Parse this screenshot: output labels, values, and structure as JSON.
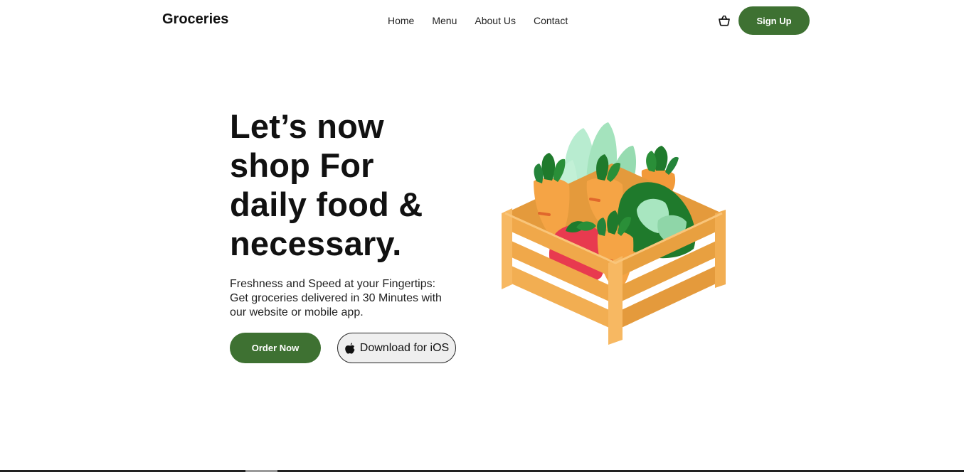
{
  "header": {
    "brand": "Groceries",
    "nav": [
      {
        "label": "Home"
      },
      {
        "label": "Menu"
      },
      {
        "label": "About Us"
      },
      {
        "label": "Contact"
      }
    ],
    "cart_icon": "shopping-basket-icon",
    "signup_label": "Sign Up"
  },
  "hero": {
    "title_lines": [
      "Let’s now",
      "shop For",
      "daily food &",
      "necessary."
    ],
    "subtitle_lines": [
      "Freshness and Speed at your Fingertips:",
      "Get groceries delivered in 30 Minutes with",
      "our website or mobile app."
    ],
    "order_label": "Order Now",
    "ios_label": "Download for iOS",
    "ios_icon": "apple-logo-icon",
    "illustration": "vegetable-crate-illustration"
  },
  "colors": {
    "accent": "#3e7132",
    "crate": "#f0a84a",
    "carrot": "#f29a3a",
    "leaf_dark": "#1f7a2c",
    "leaf_light": "#a8e6c0",
    "tomato": "#e83a4f"
  }
}
